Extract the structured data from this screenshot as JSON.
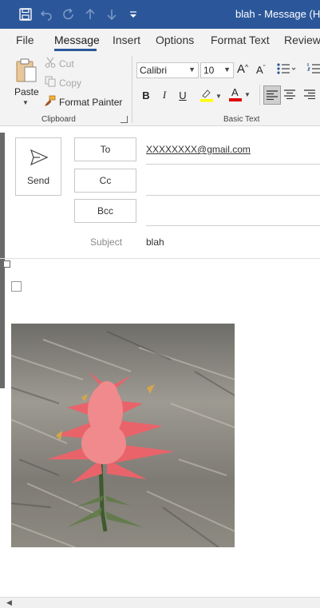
{
  "title_bar": {
    "title": "blah - Message (HT",
    "icons": [
      "save-icon",
      "undo-icon",
      "redo-icon",
      "up-arrow-icon",
      "down-arrow-icon",
      "customize-qat-icon"
    ]
  },
  "tabs": [
    "File",
    "Message",
    "Insert",
    "Options",
    "Format Text",
    "Review"
  ],
  "active_tab": "Message",
  "clipboard": {
    "paste": "Paste",
    "cut": "Cut",
    "copy": "Copy",
    "format_painter": "Format Painter",
    "group_label": "Clipboard"
  },
  "basic_text": {
    "font": "Calibri",
    "size": "10",
    "bold": "B",
    "italic": "I",
    "underline": "U",
    "font_color_glyph": "A",
    "grow_font": "A",
    "shrink_font": "A",
    "group_label": "Basic Text",
    "highlight_color": "#ffff00",
    "font_color": "#e00000"
  },
  "compose": {
    "send": "Send",
    "to_button": "To",
    "cc_button": "Cc",
    "bcc_button": "Bcc",
    "to_value": "XXXXXXXX@gmail.com",
    "subject_label": "Subject",
    "subject_value": "blah"
  },
  "colors": {
    "accent": "#2b579a",
    "ribbon_bg": "#f3f3f3"
  }
}
